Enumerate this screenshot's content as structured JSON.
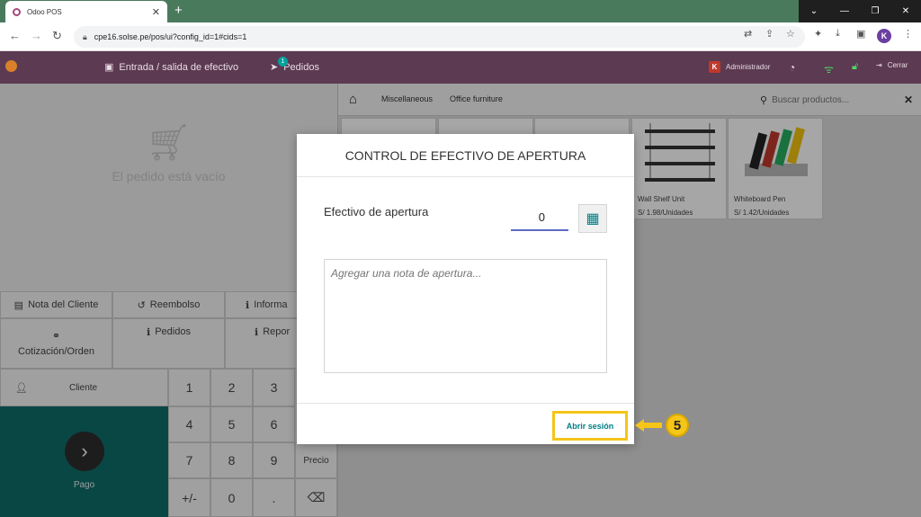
{
  "browser": {
    "tab_title": "Odoo POS",
    "url": "cpe16.solse.pe/pos/ui?config_id=1#cids=1",
    "profile_initial": "K"
  },
  "header": {
    "cash_in_out": "Entrada / salida de efectivo",
    "orders": "Pedidos",
    "orders_count": "1",
    "user_initial": "K",
    "user": "Administrador",
    "close": "Cerrar"
  },
  "left": {
    "empty_message": "El pedido está vacío",
    "controls": {
      "customer_note": "Nota del Cliente",
      "refund": "Reembolso",
      "info": "Informa",
      "quotation": "Cotización/Orden",
      "orders": "Pedidos",
      "report": "Repor"
    },
    "numpad": {
      "customer": "Cliente",
      "keys": [
        "1",
        "2",
        "3",
        "4",
        "5",
        "6",
        "7",
        "8",
        "9",
        "+/-",
        "0",
        "."
      ],
      "price": "Precio"
    },
    "payment": "Pago"
  },
  "right": {
    "categories": [
      "Miscellaneous",
      "Office furniture"
    ],
    "search_placeholder": "Buscar productos...",
    "products": [
      {
        "name": "Wall Shelf Unit",
        "price": "S/ 1.98/Unidades"
      },
      {
        "name": "Whiteboard Pen",
        "price": "S/ 1.42/Unidades"
      }
    ]
  },
  "modal": {
    "title": "CONTROL DE EFECTIVO DE APERTURA",
    "amount_label": "Efectivo de apertura",
    "amount_value": "0",
    "note_placeholder": "Agregar una nota de apertura...",
    "open_button": "Abrir sesión"
  },
  "annotation": {
    "step": "5"
  },
  "colors": {
    "pos_header": "#5c3a52",
    "teal": "#017e84",
    "highlight": "#f5c518"
  }
}
